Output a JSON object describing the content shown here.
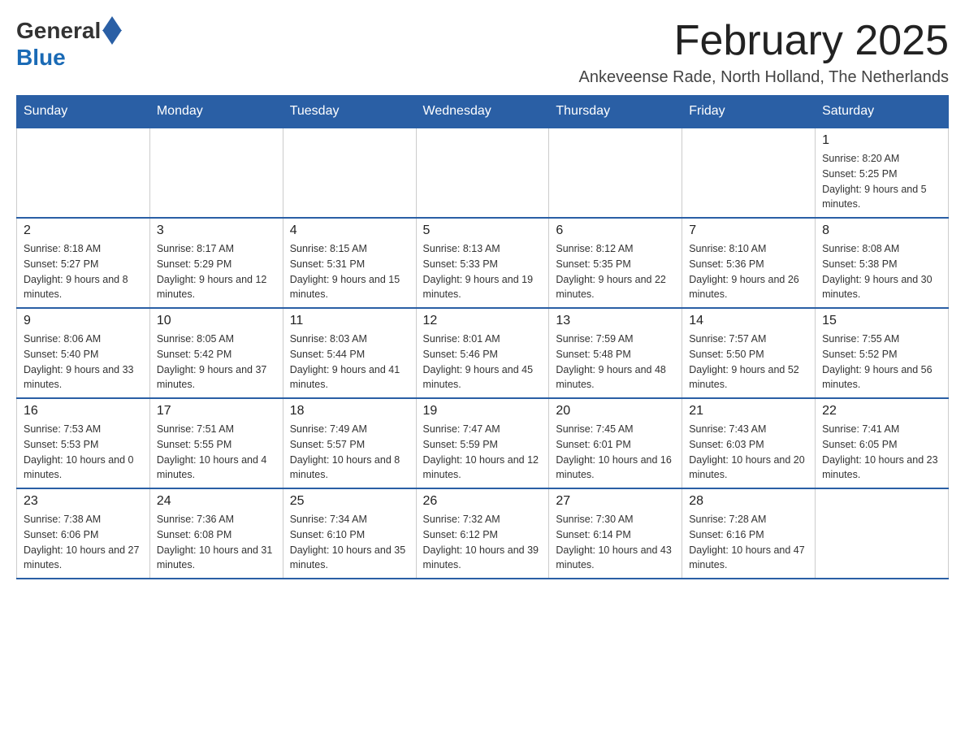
{
  "header": {
    "logo": {
      "general": "General",
      "blue": "Blue"
    },
    "title": "February 2025",
    "location": "Ankeveense Rade, North Holland, The Netherlands"
  },
  "days_of_week": [
    "Sunday",
    "Monday",
    "Tuesday",
    "Wednesday",
    "Thursday",
    "Friday",
    "Saturday"
  ],
  "weeks": [
    [
      {
        "day": "",
        "info": ""
      },
      {
        "day": "",
        "info": ""
      },
      {
        "day": "",
        "info": ""
      },
      {
        "day": "",
        "info": ""
      },
      {
        "day": "",
        "info": ""
      },
      {
        "day": "",
        "info": ""
      },
      {
        "day": "1",
        "info": "Sunrise: 8:20 AM\nSunset: 5:25 PM\nDaylight: 9 hours and 5 minutes."
      }
    ],
    [
      {
        "day": "2",
        "info": "Sunrise: 8:18 AM\nSunset: 5:27 PM\nDaylight: 9 hours and 8 minutes."
      },
      {
        "day": "3",
        "info": "Sunrise: 8:17 AM\nSunset: 5:29 PM\nDaylight: 9 hours and 12 minutes."
      },
      {
        "day": "4",
        "info": "Sunrise: 8:15 AM\nSunset: 5:31 PM\nDaylight: 9 hours and 15 minutes."
      },
      {
        "day": "5",
        "info": "Sunrise: 8:13 AM\nSunset: 5:33 PM\nDaylight: 9 hours and 19 minutes."
      },
      {
        "day": "6",
        "info": "Sunrise: 8:12 AM\nSunset: 5:35 PM\nDaylight: 9 hours and 22 minutes."
      },
      {
        "day": "7",
        "info": "Sunrise: 8:10 AM\nSunset: 5:36 PM\nDaylight: 9 hours and 26 minutes."
      },
      {
        "day": "8",
        "info": "Sunrise: 8:08 AM\nSunset: 5:38 PM\nDaylight: 9 hours and 30 minutes."
      }
    ],
    [
      {
        "day": "9",
        "info": "Sunrise: 8:06 AM\nSunset: 5:40 PM\nDaylight: 9 hours and 33 minutes."
      },
      {
        "day": "10",
        "info": "Sunrise: 8:05 AM\nSunset: 5:42 PM\nDaylight: 9 hours and 37 minutes."
      },
      {
        "day": "11",
        "info": "Sunrise: 8:03 AM\nSunset: 5:44 PM\nDaylight: 9 hours and 41 minutes."
      },
      {
        "day": "12",
        "info": "Sunrise: 8:01 AM\nSunset: 5:46 PM\nDaylight: 9 hours and 45 minutes."
      },
      {
        "day": "13",
        "info": "Sunrise: 7:59 AM\nSunset: 5:48 PM\nDaylight: 9 hours and 48 minutes."
      },
      {
        "day": "14",
        "info": "Sunrise: 7:57 AM\nSunset: 5:50 PM\nDaylight: 9 hours and 52 minutes."
      },
      {
        "day": "15",
        "info": "Sunrise: 7:55 AM\nSunset: 5:52 PM\nDaylight: 9 hours and 56 minutes."
      }
    ],
    [
      {
        "day": "16",
        "info": "Sunrise: 7:53 AM\nSunset: 5:53 PM\nDaylight: 10 hours and 0 minutes."
      },
      {
        "day": "17",
        "info": "Sunrise: 7:51 AM\nSunset: 5:55 PM\nDaylight: 10 hours and 4 minutes."
      },
      {
        "day": "18",
        "info": "Sunrise: 7:49 AM\nSunset: 5:57 PM\nDaylight: 10 hours and 8 minutes."
      },
      {
        "day": "19",
        "info": "Sunrise: 7:47 AM\nSunset: 5:59 PM\nDaylight: 10 hours and 12 minutes."
      },
      {
        "day": "20",
        "info": "Sunrise: 7:45 AM\nSunset: 6:01 PM\nDaylight: 10 hours and 16 minutes."
      },
      {
        "day": "21",
        "info": "Sunrise: 7:43 AM\nSunset: 6:03 PM\nDaylight: 10 hours and 20 minutes."
      },
      {
        "day": "22",
        "info": "Sunrise: 7:41 AM\nSunset: 6:05 PM\nDaylight: 10 hours and 23 minutes."
      }
    ],
    [
      {
        "day": "23",
        "info": "Sunrise: 7:38 AM\nSunset: 6:06 PM\nDaylight: 10 hours and 27 minutes."
      },
      {
        "day": "24",
        "info": "Sunrise: 7:36 AM\nSunset: 6:08 PM\nDaylight: 10 hours and 31 minutes."
      },
      {
        "day": "25",
        "info": "Sunrise: 7:34 AM\nSunset: 6:10 PM\nDaylight: 10 hours and 35 minutes."
      },
      {
        "day": "26",
        "info": "Sunrise: 7:32 AM\nSunset: 6:12 PM\nDaylight: 10 hours and 39 minutes."
      },
      {
        "day": "27",
        "info": "Sunrise: 7:30 AM\nSunset: 6:14 PM\nDaylight: 10 hours and 43 minutes."
      },
      {
        "day": "28",
        "info": "Sunrise: 7:28 AM\nSunset: 6:16 PM\nDaylight: 10 hours and 47 minutes."
      },
      {
        "day": "",
        "info": ""
      }
    ]
  ]
}
